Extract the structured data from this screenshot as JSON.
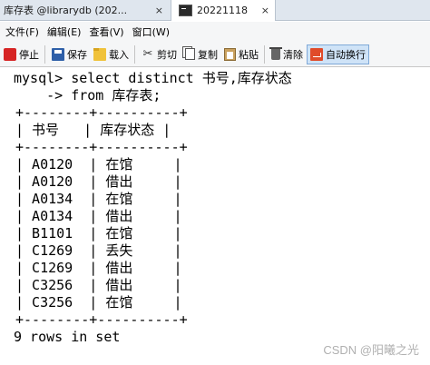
{
  "tabs": [
    {
      "label": "库存表 @librarydb (202...",
      "close": "×"
    },
    {
      "label": "20221118",
      "close": "×"
    }
  ],
  "menu": [
    "文件(F)",
    "编辑(E)",
    "查看(V)",
    "窗口(W)"
  ],
  "toolbar": [
    {
      "label": "停止",
      "icon": "stop-icon"
    },
    {
      "label": "保存",
      "icon": "save-icon"
    },
    {
      "label": "载入",
      "icon": "folder-icon"
    },
    {
      "label": "剪切",
      "icon": "scissors-icon"
    },
    {
      "label": "复制",
      "icon": "copy-icon"
    },
    {
      "label": "粘贴",
      "icon": "paste-icon"
    },
    {
      "label": "清除",
      "icon": "trash-icon"
    },
    {
      "label": "自动换行",
      "icon": "wrap-icon"
    }
  ],
  "console": {
    "prompt": "mysql> select distinct 书号,库存状态",
    "continuation": "    -> from 库存表;",
    "border": "+--------+----------+",
    "header": "| 书号   | 库存状态 |",
    "rows": [
      "| A0120  | 在馆     |",
      "| A0120  | 借出     |",
      "| A0134  | 在馆     |",
      "| A0134  | 借出     |",
      "| B1101  | 在馆     |",
      "| C1269  | 丢失     |",
      "| C1269  | 借出     |",
      "| C3256  | 借出     |",
      "| C3256  | 在馆     |"
    ],
    "footer": "9 rows in set"
  },
  "watermark": "CSDN @阳曦之光"
}
